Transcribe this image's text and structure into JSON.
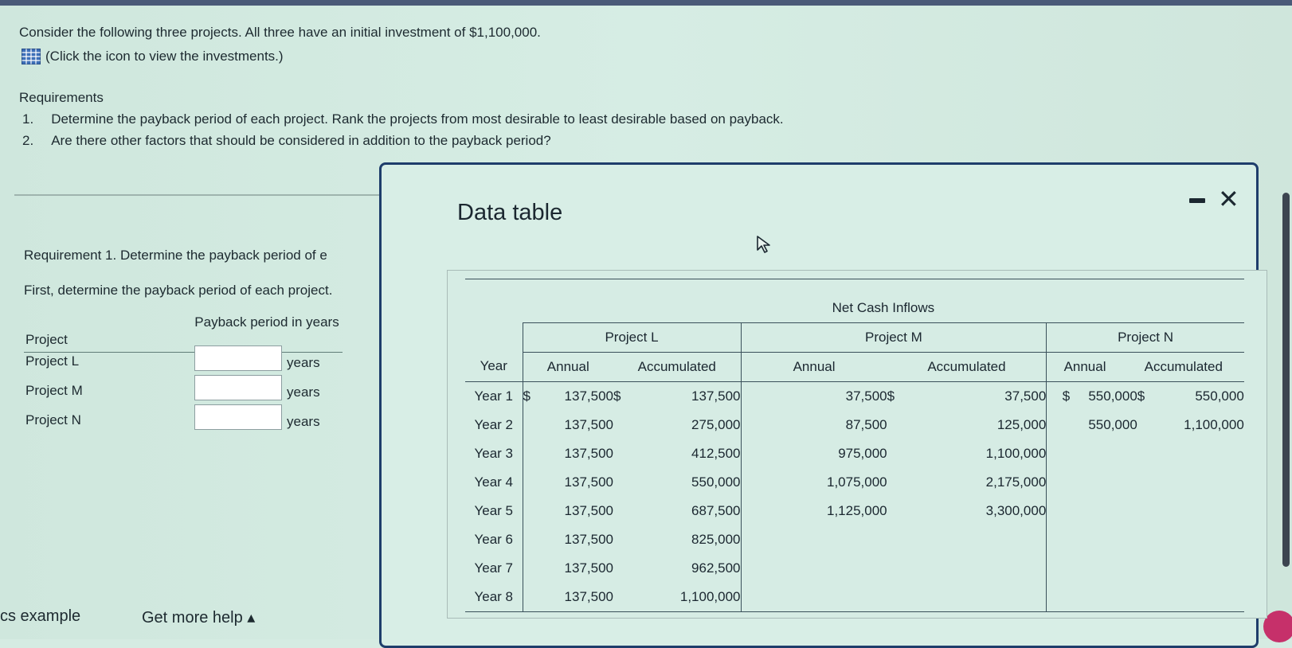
{
  "intro": {
    "text": "Consider the following three projects. All three have an initial investment of $1,100,000.",
    "icon_link": "(Click the icon to view the investments.)"
  },
  "requirements": {
    "heading": "Requirements",
    "items": [
      {
        "num": "1.",
        "text": "Determine the payback period of each project. Rank the projects from most desirable to least desirable based on payback."
      },
      {
        "num": "2.",
        "text": "Are there other factors that should be considered in addition to the payback period?"
      }
    ]
  },
  "req1": {
    "heading": "Requirement 1. Determine the payback period of e",
    "sub": "First, determine the payback period of each project."
  },
  "payback": {
    "col_project": "Project",
    "col_period": "Payback period in years",
    "unit": "years",
    "rows": [
      {
        "project": "Project L",
        "value": ""
      },
      {
        "project": "Project M",
        "value": ""
      },
      {
        "project": "Project N",
        "value": ""
      }
    ]
  },
  "footer": {
    "left": "cs example",
    "help": "Get more help ▴"
  },
  "modal": {
    "title": "Data table",
    "table": {
      "super_header": "Net Cash Inflows",
      "projects": [
        "Project L",
        "Project M",
        "Project N"
      ],
      "col_year": "Year",
      "col_annual": "Annual",
      "col_accum": "Accumulated",
      "currency": "$",
      "rows": [
        {
          "year": "Year 1",
          "l_annual": "137,500",
          "l_accum": "137,500",
          "m_annual": "37,500",
          "m_accum": "37,500",
          "n_annual": "550,000",
          "n_accum": "550,000"
        },
        {
          "year": "Year 2",
          "l_annual": "137,500",
          "l_accum": "275,000",
          "m_annual": "87,500",
          "m_accum": "125,000",
          "n_annual": "550,000",
          "n_accum": "1,100,000"
        },
        {
          "year": "Year 3",
          "l_annual": "137,500",
          "l_accum": "412,500",
          "m_annual": "975,000",
          "m_accum": "1,100,000",
          "n_annual": "",
          "n_accum": ""
        },
        {
          "year": "Year 4",
          "l_annual": "137,500",
          "l_accum": "550,000",
          "m_annual": "1,075,000",
          "m_accum": "2,175,000",
          "n_annual": "",
          "n_accum": ""
        },
        {
          "year": "Year 5",
          "l_annual": "137,500",
          "l_accum": "687,500",
          "m_annual": "1,125,000",
          "m_accum": "3,300,000",
          "n_annual": "",
          "n_accum": ""
        },
        {
          "year": "Year 6",
          "l_annual": "137,500",
          "l_accum": "825,000",
          "m_annual": "",
          "m_accum": "",
          "n_annual": "",
          "n_accum": ""
        },
        {
          "year": "Year 7",
          "l_annual": "137,500",
          "l_accum": "962,500",
          "m_annual": "",
          "m_accum": "",
          "n_annual": "",
          "n_accum": ""
        },
        {
          "year": "Year 8",
          "l_annual": "137,500",
          "l_accum": "1,100,000",
          "m_annual": "",
          "m_accum": "",
          "n_annual": "",
          "n_accum": ""
        }
      ]
    }
  },
  "colors": {
    "modal_border": "#1e3d6b",
    "accent_pink": "#c6306a",
    "icon_blue": "#3d6fb8"
  }
}
